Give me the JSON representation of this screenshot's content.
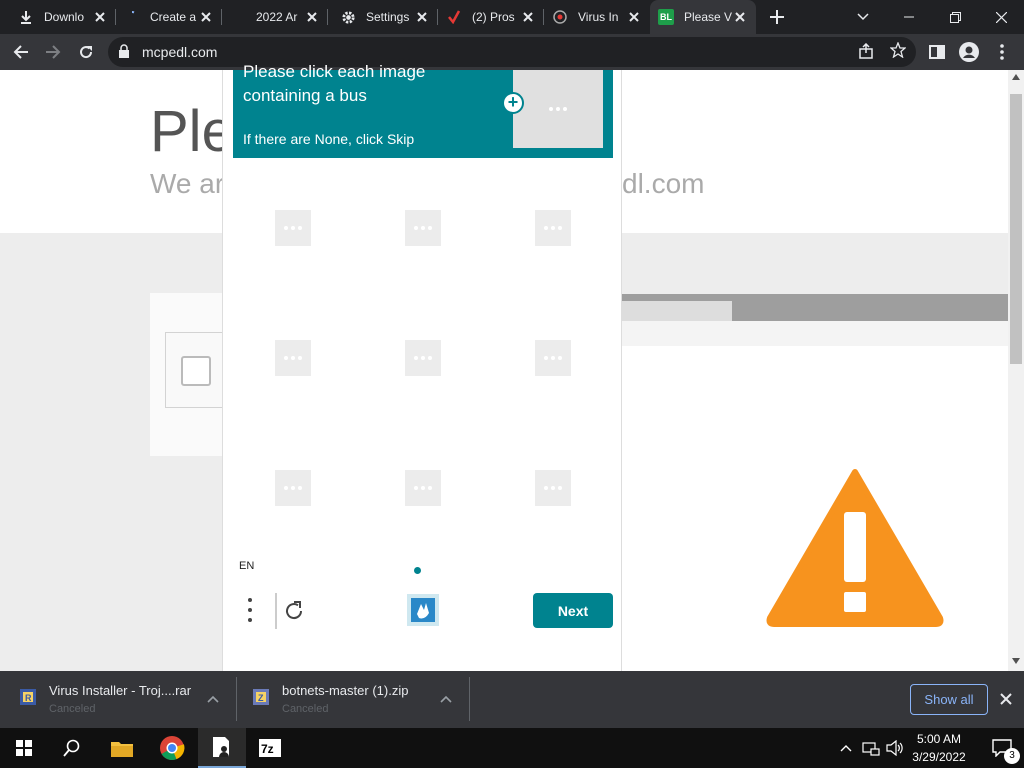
{
  "tabs": [
    {
      "title": "Downlo",
      "icon": "download-icon"
    },
    {
      "title": "Create a",
      "icon": "loading-icon"
    },
    {
      "title": "2022 Ar",
      "icon": "blank-page-icon"
    },
    {
      "title": "Settings",
      "icon": "gear-icon"
    },
    {
      "title": "(2) Pros",
      "icon": "checkmark-logo-icon"
    },
    {
      "title": "Virus In",
      "icon": "globe-icon"
    },
    {
      "title": "Please V",
      "icon": "bl-logo-icon",
      "active": true
    }
  ],
  "toolbar": {
    "url": "mcpedl.com"
  },
  "page": {
    "heading": "Ple",
    "subheading_left": "We ar",
    "subheading_right": "dl.com"
  },
  "captcha": {
    "line1": "Please click each image",
    "line2": "containing a bus",
    "line3": "If there are None, click Skip",
    "language": "EN",
    "next_label": "Next"
  },
  "downloads": [
    {
      "name": "Virus Installer - Troj....rar",
      "status": "Canceled",
      "icon": "winrar-file-icon"
    },
    {
      "name": "botnets-master (1).zip",
      "status": "Canceled",
      "icon": "zip-file-icon"
    }
  ],
  "download_bar": {
    "show_all_label": "Show all"
  },
  "taskbar": {
    "time": "5:00 AM",
    "date": "3/29/2022",
    "notification_count": "3"
  },
  "colors": {
    "captcha_accent": "#00838f",
    "warning_orange": "#f7931e",
    "link_blue": "#8ab4f8"
  }
}
